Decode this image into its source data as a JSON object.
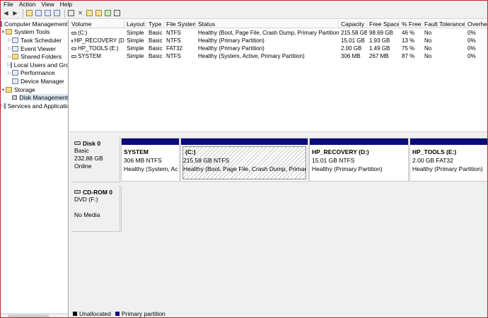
{
  "menu": [
    "File",
    "Action",
    "View",
    "Help"
  ],
  "toolbar": [
    "back-icon",
    "forward-icon",
    "up-icon",
    "show-hide-tree-icon",
    "help-icon",
    "properties-icon",
    "delete-icon",
    "open-icon",
    "folder-icon",
    "rescan-icon",
    "refresh-icon"
  ],
  "tree": {
    "items": [
      {
        "label": "Computer Management (Local",
        "indent": 0,
        "expander": "",
        "icon": "computer-icon"
      },
      {
        "label": "System Tools",
        "indent": 1,
        "expander": "▲",
        "icon": "tools-icon"
      },
      {
        "label": "Task Scheduler",
        "indent": 2,
        "expander": "▷",
        "icon": "scheduler-icon"
      },
      {
        "label": "Event Viewer",
        "indent": 2,
        "expander": "▷",
        "icon": "event-viewer-icon"
      },
      {
        "label": "Shared Folders",
        "indent": 2,
        "expander": "▷",
        "icon": "shared-folders-icon"
      },
      {
        "label": "Local Users and Groups",
        "indent": 2,
        "expander": "▷",
        "icon": "users-icon"
      },
      {
        "label": "Performance",
        "indent": 2,
        "expander": "▷",
        "icon": "performance-icon"
      },
      {
        "label": "Device Manager",
        "indent": 2,
        "expander": "",
        "icon": "device-manager-icon"
      },
      {
        "label": "Storage",
        "indent": 1,
        "expander": "▲",
        "icon": "storage-icon"
      },
      {
        "label": "Disk Management",
        "indent": 2,
        "expander": "",
        "icon": "disk-icon"
      },
      {
        "label": "Services and Applications",
        "indent": 1,
        "expander": "▷",
        "icon": "services-icon"
      }
    ]
  },
  "volumes": {
    "columns": [
      "Volume",
      "Layout",
      "Type",
      "File System",
      "Status",
      "Capacity",
      "Free Space",
      "% Free",
      "Fault Tolerance",
      "Overhead"
    ],
    "rows": [
      [
        "(C:)",
        "Simple",
        "Basic",
        "NTFS",
        "Healthy (Boot, Page File, Crash Dump, Primary Partition)",
        "215.58 GB",
        "98.69 GB",
        "46 %",
        "No",
        "0%"
      ],
      [
        "HP_RECOVERY (D:)",
        "Simple",
        "Basic",
        "NTFS",
        "Healthy (Primary Partition)",
        "15.01 GB",
        "1.93 GB",
        "13 %",
        "No",
        "0%"
      ],
      [
        "HP_TOOLS (E:)",
        "Simple",
        "Basic",
        "FAT32",
        "Healthy (Primary Partition)",
        "2.00 GB",
        "1.49 GB",
        "75 %",
        "No",
        "0%"
      ],
      [
        "SYSTEM",
        "Simple",
        "Basic",
        "NTFS",
        "Healthy (System, Active, Primary Partition)",
        "306 MB",
        "267 MB",
        "87 %",
        "No",
        "0%"
      ]
    ]
  },
  "disks": {
    "disk0": {
      "name": "Disk 0",
      "type": "Basic",
      "size": "232.88 GB",
      "status": "Online"
    },
    "cdrom0": {
      "name": "CD-ROM 0",
      "type": "DVD (F:)",
      "status": "No Media"
    },
    "partitions": [
      {
        "title": "SYSTEM",
        "size": "306 MB NTFS",
        "status": "Healthy (System, Active, Primary Partition)"
      },
      {
        "title": "(C:)",
        "size": "215.58 GB NTFS",
        "status": "Healthy (Boot, Page File, Crash Dump, Primary Partition)"
      },
      {
        "title": "HP_RECOVERY  (D:)",
        "size": "15.01 GB NTFS",
        "status": "Healthy (Primary Partition)"
      },
      {
        "title": "HP_TOOLS  (E:)",
        "size": "2.00 GB FAT32",
        "status": "Healthy (Primary Partition)"
      }
    ]
  },
  "legend": [
    {
      "label": "Unallocated",
      "color": "#000000"
    },
    {
      "label": "Primary partition",
      "color": "#0a0a78"
    }
  ]
}
